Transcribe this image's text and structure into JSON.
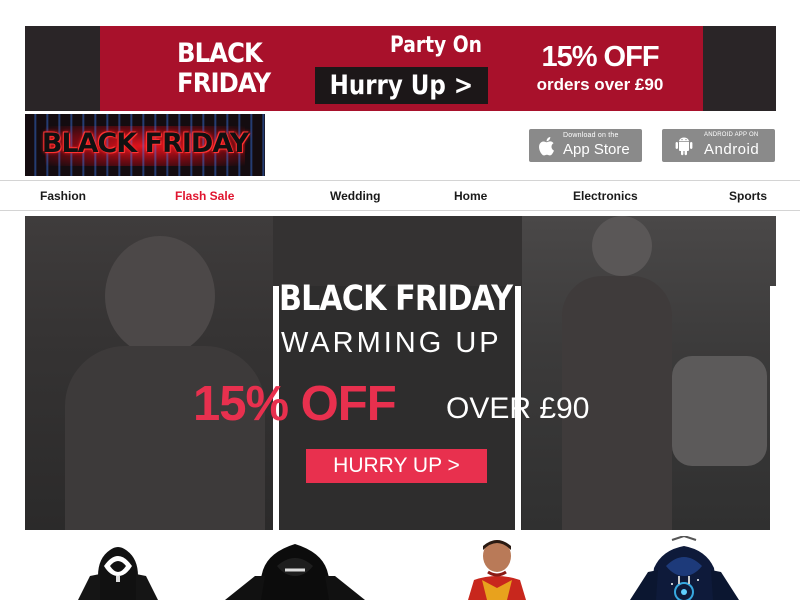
{
  "promo_banner": {
    "left_title_line1": "BLACK",
    "left_title_line2": "FRIDAY",
    "center_title": "Party On",
    "button_label": "Hurry Up >",
    "discount": "15% OFF",
    "condition": "orders over £90"
  },
  "logo": {
    "text": "BLACK FRIDAY"
  },
  "app_badges": [
    {
      "small": "Download on the",
      "big": "App Store",
      "icon": "apple-icon"
    },
    {
      "small": "ANDROID APP ON",
      "big": "Android",
      "icon": "android-icon"
    }
  ],
  "nav": {
    "items": [
      "Fashion",
      "Flash Sale",
      "Wedding",
      "Home",
      "Electronics",
      "Sports"
    ],
    "highlight_color": "#e0152f"
  },
  "hero": {
    "title": "BLACK FRIDAY",
    "subtitle": "WARMING UP",
    "discount": "15% OFF",
    "condition": "OVER £90",
    "button_label": "HURRY UP >",
    "accent": "#e8304e"
  },
  "products": [
    {
      "name": "black-white-hoodie"
    },
    {
      "name": "black-hoodie"
    },
    {
      "name": "kid-red-hoodie"
    },
    {
      "name": "galaxy-hoodie"
    }
  ]
}
